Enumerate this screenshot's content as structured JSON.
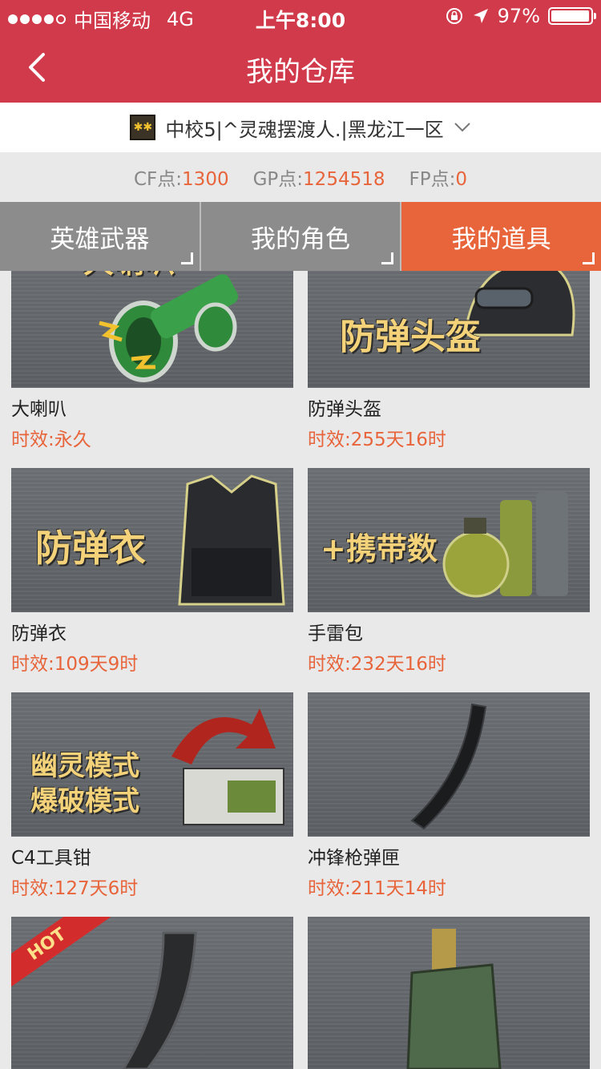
{
  "status_bar": {
    "carrier": "中国移动",
    "network": "4G",
    "time": "上午8:00",
    "battery_text": "97%",
    "battery_level": 0.97
  },
  "header": {
    "title": "我的仓库"
  },
  "server": {
    "label": "中校5|^灵魂摆渡人.|黑龙江一区"
  },
  "points": [
    {
      "label": "CF点:",
      "value": "1300"
    },
    {
      "label": "GP点:",
      "value": "1254518"
    },
    {
      "label": "FP点:",
      "value": "0"
    }
  ],
  "tabs": [
    {
      "label": "英雄武器",
      "active": false
    },
    {
      "label": "我的角色",
      "active": false
    },
    {
      "label": "我的道具",
      "active": true
    }
  ],
  "items": [
    {
      "name": "大喇叭",
      "duration": "时效:永久",
      "art_text": "大喇叭",
      "icon": "megaphone-icon"
    },
    {
      "name": "防弹头盔",
      "duration": "时效:255天16时",
      "art_text": "防弹头盔",
      "icon": "helmet-icon"
    },
    {
      "name": "防弹衣",
      "duration": "时效:109天9时",
      "art_text": "防弹衣",
      "icon": "vest-icon"
    },
    {
      "name": "手雷包",
      "duration": "时效:232天16时",
      "art_text": "+携带数",
      "icon": "grenade-icon"
    },
    {
      "name": "C4工具钳",
      "duration": "时效:127天6时",
      "art_text": "幽灵模式\n爆破模式",
      "icon": "c4-icon"
    },
    {
      "name": "冲锋枪弹匣",
      "duration": "时效:211天14时",
      "art_text": "",
      "icon": "magazine-icon"
    },
    {
      "name": "",
      "duration": "",
      "art_text": "HOT",
      "icon": "rifle-magazine-icon"
    },
    {
      "name": "",
      "duration": "",
      "art_text": "",
      "icon": "ammo-box-icon"
    }
  ],
  "colors": {
    "header_bg": "#d03a4a",
    "accent": "#e8643a",
    "tab_inactive": "#8c8c8c",
    "page_bg": "#e9e9ea"
  }
}
